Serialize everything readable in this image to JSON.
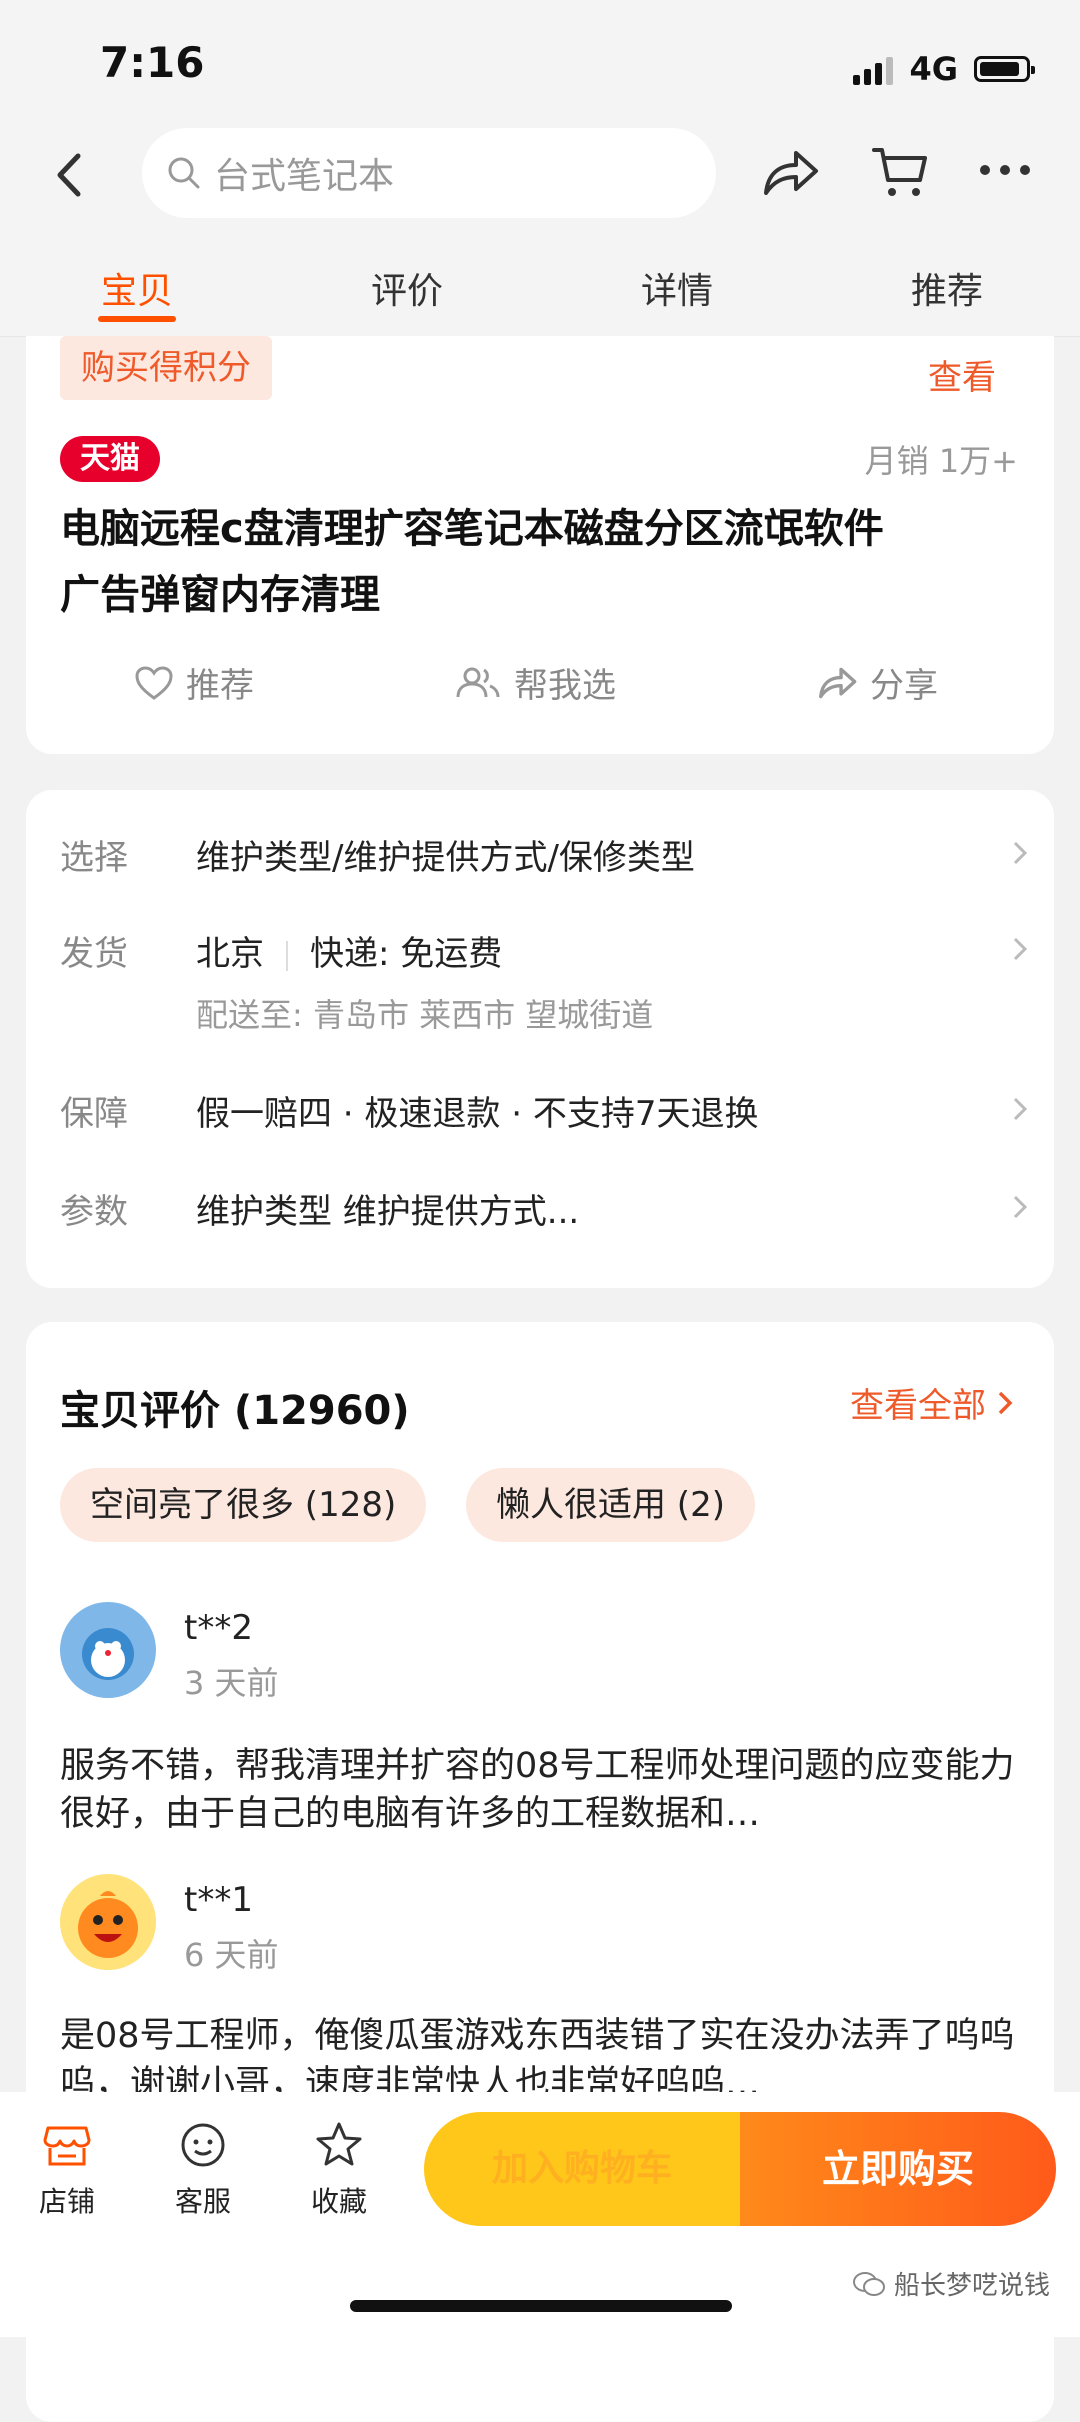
{
  "status": {
    "time": "7:16",
    "network": "4G"
  },
  "nav": {
    "search_placeholder": "台式笔记本"
  },
  "tabs": [
    {
      "label": "宝贝",
      "active": true
    },
    {
      "label": "评价",
      "active": false
    },
    {
      "label": "详情",
      "active": false
    },
    {
      "label": "推荐",
      "active": false
    }
  ],
  "product": {
    "points_badge": "购买得积分",
    "view_link": "查看",
    "store_badge": "天猫",
    "monthly_sales": "月销 1万+",
    "title_line1": "电脑远程c盘清理扩容笔记本磁盘分区流氓软件",
    "title_line2": "广告弹窗内存清理",
    "actions": [
      "推荐",
      "帮我选",
      "分享"
    ]
  },
  "specs": {
    "select_label": "选择",
    "select_value": "维护类型/维护提供方式/保修类型",
    "ship_label": "发货",
    "ship_from": "北京",
    "ship_fee": "快递: 免运费",
    "ship_to": "配送至: 青岛市 莱西市 望城街道",
    "guarantee_label": "保障",
    "guarantee_value": "假一赔四 · 极速退款 · 不支持7天退换",
    "params_label": "参数",
    "params_value": "维护类型 维护提供方式..."
  },
  "reviews": {
    "title": "宝贝评价 (12960)",
    "see_all": "查看全部",
    "tags": [
      "空间亮了很多 (128)",
      "懒人很适用 (2)"
    ],
    "items": [
      {
        "user": "t**2",
        "time": "3 天前",
        "text": "服务不错，帮我清理并扩容的08号工程师处理问题的应变能力很好，由于自己的电脑有许多的工程数据和…"
      },
      {
        "user": "t**1",
        "time": "6 天前",
        "text": "是08号工程师，俺傻瓜蛋游戏东西装错了实在没办法弄了呜呜呜，谢谢小哥，速度非常快人也非常好呜呜…"
      }
    ]
  },
  "bottom": {
    "store": "店铺",
    "service": "客服",
    "favorite": "收藏",
    "add_cart": "加入购物车",
    "buy_now": "立即购买"
  },
  "watermark": "船长梦呓说钱",
  "colors": {
    "accent": "#ff5000",
    "tmall": "#e8002d",
    "buy": "#ff5a1a",
    "cart": "#ffc71a"
  }
}
